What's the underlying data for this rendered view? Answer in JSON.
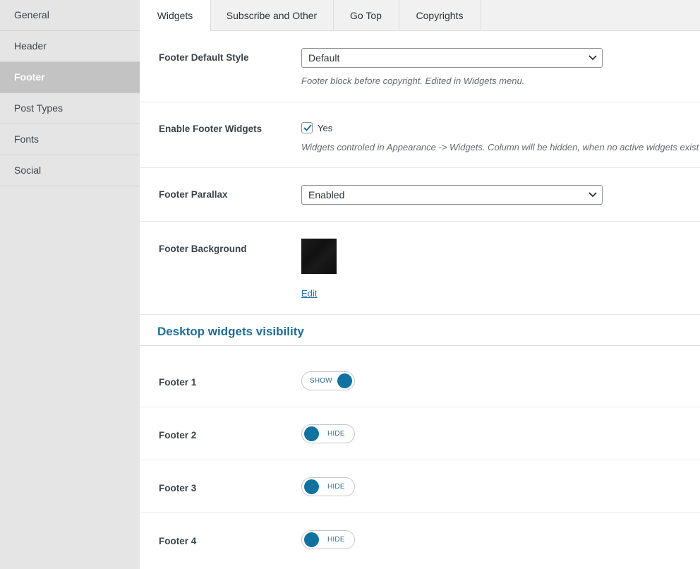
{
  "sidebar": {
    "items": [
      {
        "label": "General"
      },
      {
        "label": "Header"
      },
      {
        "label": "Footer"
      },
      {
        "label": "Post Types"
      },
      {
        "label": "Fonts"
      },
      {
        "label": "Social"
      }
    ]
  },
  "tabs": [
    {
      "label": "Widgets"
    },
    {
      "label": "Subscribe and Other"
    },
    {
      "label": "Go Top"
    },
    {
      "label": "Copyrights"
    }
  ],
  "fields": {
    "footer_style": {
      "label": "Footer Default Style",
      "value": "Default",
      "description": "Footer block before copyright. Edited in Widgets menu."
    },
    "footer_widgets": {
      "label": "Enable Footer Widgets",
      "checkbox_label": "Yes",
      "checked": true,
      "description": "Widgets controled in Appearance -> Widgets. Column will be hidden, when no active widgets exist"
    },
    "footer_parallax": {
      "label": "Footer Parallax",
      "value": "Enabled"
    },
    "footer_background": {
      "label": "Footer Background",
      "edit_label": "Edit"
    }
  },
  "visibility": {
    "title": "Desktop widgets visibility",
    "rows": [
      {
        "label": "Footer 1",
        "state": "SHOW"
      },
      {
        "label": "Footer 2",
        "state": "HIDE"
      },
      {
        "label": "Footer 3",
        "state": "HIDE"
      },
      {
        "label": "Footer 4",
        "state": "HIDE"
      }
    ]
  },
  "colors": {
    "accent": "#0e73a0",
    "sidebar_bg": "#e5e5e5",
    "sidebar_active_bg": "#c3c3c3",
    "link": "#2271b1"
  }
}
